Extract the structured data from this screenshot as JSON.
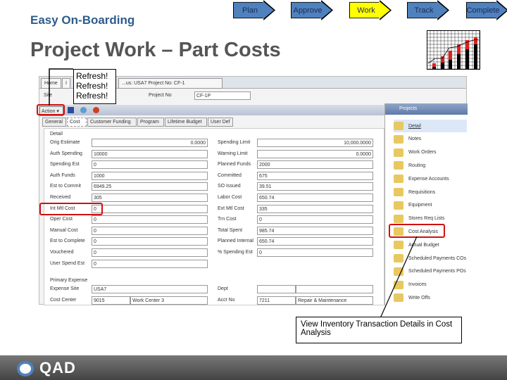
{
  "header": {
    "brand": "Easy On-Boarding",
    "title": "Project Work – Part Costs"
  },
  "steps": [
    {
      "label": "Plan",
      "active": false
    },
    {
      "label": "Approve",
      "active": false
    },
    {
      "label": "Work",
      "active": true
    },
    {
      "label": "Track",
      "active": false
    },
    {
      "label": "Complete",
      "active": false
    }
  ],
  "colors": {
    "step": "#4f81bd",
    "step_active": "#ffff00",
    "highlight": "#d01010",
    "brand": "#2e5c8a"
  },
  "app": {
    "doc_tabs": [
      "Home",
      "I",
      "...us: USA7 Project No: CF-1"
    ],
    "site_label": "Site",
    "project_label": "Project No",
    "project_value": "CF-1P",
    "action_label": "Action",
    "form_tabs": [
      "General",
      "Cost",
      "Customer Funding",
      "Program",
      "Lifetime Budget",
      "User Def"
    ],
    "section_detail": "Detail",
    "section_expense": "Primary Expense",
    "left_fields": [
      {
        "label": "Orig Estimate",
        "value": "0.0000"
      },
      {
        "label": "Auth Spending",
        "value": "10000"
      },
      {
        "label": "Spending Est",
        "value": "0"
      },
      {
        "label": "Auth Funds",
        "value": "1000"
      },
      {
        "label": "Est to Commit",
        "value": "6949.25"
      },
      {
        "label": "Received",
        "value": "305"
      },
      {
        "label": "Int Mtl Cost",
        "value": "0"
      },
      {
        "label": "Oper Cost",
        "value": "0"
      },
      {
        "label": "Manual Cost",
        "value": "0"
      },
      {
        "label": "Est to Complete",
        "value": "0"
      },
      {
        "label": "Vouchered",
        "value": "0"
      },
      {
        "label": "User Spend Est",
        "value": "0"
      }
    ],
    "right_fields": [
      {
        "label": "Spending Limit",
        "value": "10,000.0000"
      },
      {
        "label": "Warning Limit",
        "value": "0.0000"
      },
      {
        "label": "Planned Funds",
        "value": "2000"
      },
      {
        "label": "Committed",
        "value": "675"
      },
      {
        "label": "SO Issued",
        "value": "39.51"
      },
      {
        "label": "Labor Cost",
        "value": "650.74"
      },
      {
        "label": "Ext Mtl Cost",
        "value": "335"
      },
      {
        "label": "Trn Cost",
        "value": "0"
      },
      {
        "label": "Total Spent",
        "value": "985.74"
      },
      {
        "label": "Planned Internal",
        "value": "650.74"
      },
      {
        "label": "% Spending Est",
        "value": "0"
      }
    ],
    "expense_fields": [
      {
        "label": "Expense Site",
        "value": "USA7"
      },
      {
        "label": "Cost Center",
        "value": "9015",
        "value2": "Work Center 3"
      }
    ],
    "expense_right": [
      {
        "label": "Dept",
        "value": "",
        "value2": ""
      },
      {
        "label": "Acct No",
        "value": "7211",
        "value2": "Repair & Maintenance"
      }
    ],
    "panel_title": "Projects",
    "panel_items": [
      "Detail",
      "Notes",
      "Work Orders",
      "Routing",
      "Expense Accounts",
      "Requisitions",
      "Equipment",
      "Stores Req Lists",
      "Cost Analysis",
      "Actual Budget",
      "Scheduled Payments COs",
      "Scheduled Payments POs",
      "Invoices",
      "Write Offs"
    ]
  },
  "callouts": {
    "refresh": [
      "Refresh!",
      "Refresh!",
      "Refresh!"
    ],
    "inventory": "View Inventory Transaction Details in Cost Analysis"
  },
  "footer": {
    "logo": "QAD"
  }
}
